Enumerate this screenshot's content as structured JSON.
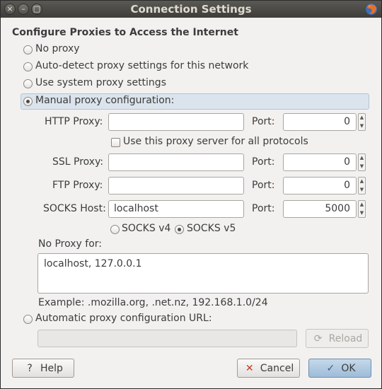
{
  "window": {
    "title": "Connection Settings",
    "controls": {
      "close": "×",
      "minimize": "–",
      "maximize": "□"
    }
  },
  "heading": "Configure Proxies to Access the Internet",
  "options": {
    "no_proxy": "No proxy",
    "auto_detect": "Auto-detect proxy settings for this network",
    "system": "Use system proxy settings",
    "manual": "Manual proxy configuration:",
    "auto_url": "Automatic proxy configuration URL:",
    "selected": "manual"
  },
  "manual": {
    "http_label": "HTTP Proxy:",
    "http_value": "",
    "port_label": "Port:",
    "http_port": "0",
    "use_for_all": "Use this proxy server for all protocols",
    "ssl_label": "SSL Proxy:",
    "ssl_value": "",
    "ssl_port": "0",
    "ftp_label": "FTP Proxy:",
    "ftp_value": "",
    "ftp_port": "0",
    "socks_label": "SOCKS Host:",
    "socks_value": "localhost",
    "socks_port": "5000",
    "socks_v4": "SOCKS v4",
    "socks_v5": "SOCKS v5",
    "socks_selected": "v5"
  },
  "no_proxy_for": {
    "label": "No Proxy for:",
    "value": "localhost, 127.0.0.1",
    "example": "Example: .mozilla.org, .net.nz, 192.168.1.0/24"
  },
  "auto_url": {
    "value": ""
  },
  "buttons": {
    "reload": "Reload",
    "help": "Help",
    "cancel": "Cancel",
    "ok": "OK"
  },
  "icons": {
    "help": "?",
    "cancel": "✕",
    "ok": "✓",
    "reload": "⟳",
    "app": "firefox-icon"
  },
  "colors": {
    "titlebar": "#3e3d39",
    "window_bg": "#f2f1f0",
    "ok_button": "#9dbbd8",
    "selected_row": "#dbe4ec"
  }
}
